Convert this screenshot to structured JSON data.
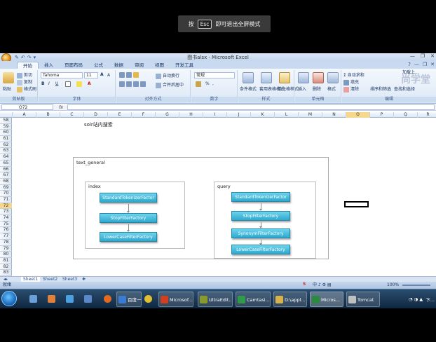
{
  "overlay": {
    "press": "按",
    "key": "Esc",
    "hint": "即可退出全屏模式"
  },
  "window": {
    "title": "图书alsx - Microsoft Excel",
    "qat": [
      "✎",
      "↶",
      "↷",
      "▾"
    ]
  },
  "tabs": [
    "开始",
    "插入",
    "页面布局",
    "公式",
    "数据",
    "审阅",
    "视图",
    "开发工具"
  ],
  "ribbon": {
    "clipboard": {
      "label": "剪贴板",
      "paste": "粘贴",
      "cut": "剪切",
      "copy": "复制",
      "format_painter": "格式刷"
    },
    "font": {
      "label": "字体",
      "name": "Tahoma",
      "size": "11",
      "grow": "A",
      "shrink": "A",
      "bold": "B",
      "italic": "I",
      "underline": "U",
      "color_a": "A"
    },
    "alignment": {
      "label": "对齐方式",
      "wrap": "自动换行",
      "merge": "合并后居中"
    },
    "number": {
      "label": "数字",
      "format": "常规",
      "percent": "%",
      "comma": ","
    },
    "styles": {
      "label": "样式",
      "conditional": "条件格式",
      "table": "套用表格格式",
      "cell": "单元格样式"
    },
    "cells": {
      "label": "单元格",
      "insert": "插入",
      "delete": "删除",
      "format": "格式"
    },
    "editing": {
      "label": "编辑",
      "autosum": "自动求和",
      "fill": "填充",
      "clear": "清除",
      "sort": "排序和筛选",
      "find": "查找和选择"
    },
    "share": "加载上..."
  },
  "formula_bar": {
    "name_box": "O72",
    "fx": "fx",
    "value": ""
  },
  "columns": [
    "A",
    "B",
    "C",
    "D",
    "E",
    "F",
    "G",
    "H",
    "I",
    "J",
    "K",
    "L",
    "M",
    "N",
    "O",
    "P",
    "Q",
    "R"
  ],
  "rows": [
    "58",
    "59",
    "60",
    "61",
    "62",
    "63",
    "64",
    "65",
    "66",
    "67",
    "68",
    "69",
    "70",
    "71",
    "72",
    "73",
    "74",
    "75",
    "76",
    "77",
    "78",
    "79",
    "80",
    "81",
    "82",
    "83"
  ],
  "diagram": {
    "title": "solr站内搜索",
    "outer_label": "text_general",
    "index": {
      "label": "index",
      "nodes": [
        "StandardTokenizerFactor",
        "StopFilterFactory",
        "LowerCaseFilterFactory"
      ]
    },
    "query": {
      "label": "query",
      "nodes": [
        "StandardTokenizerFactor",
        "StopFilterFactory",
        "SynonymFilterFactory",
        "LowerCaseFilterFactory"
      ]
    }
  },
  "sheets": [
    "Sheet1",
    "Sheet2",
    "Sheet3"
  ],
  "status": {
    "ready": "就绪",
    "zoom": "100%"
  },
  "taskbar": {
    "apps": [
      {
        "label": "百度一下...",
        "color": "#3a7bd5"
      },
      {
        "label": "Microsof...",
        "color": "#d04020"
      },
      {
        "label": "UltraEdit...",
        "color": "#8a9a2a"
      },
      {
        "label": "Camtasi...",
        "color": "#2f9a4a"
      },
      {
        "label": "D:\\appl...",
        "color": "#d8b24a"
      },
      {
        "label": "Micros...",
        "color": "#2b8a3e"
      },
      {
        "label": "Tomcat",
        "color": "#c0c0c0"
      }
    ],
    "clock": "下..."
  }
}
